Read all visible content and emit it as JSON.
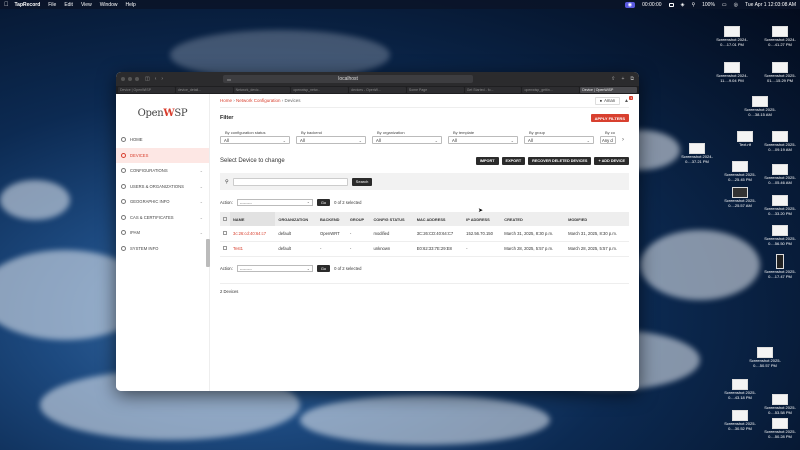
{
  "menubar": {
    "app": "TapRecord",
    "items": [
      "File",
      "Edit",
      "View",
      "Window",
      "Help"
    ],
    "recording_time": "00:00:00",
    "battery": "100%",
    "datetime": "Tue Apr 1 12:03:08 AM"
  },
  "desktop_icons": [
    {
      "label": "Screenshot 2024-0....41.27 PM"
    },
    {
      "label": "Screenshot 2024-0....17.01 PM"
    },
    {
      "label": "Screenshot 2025-01....15.29 PM"
    },
    {
      "label": "Screenshot 2024-11....9.04 PM"
    },
    {
      "label": "Screenshot 2025-0....38.15 AM"
    },
    {
      "label": "Text.rtf"
    },
    {
      "label": "Screenshot 2025-0....09.19 AM"
    },
    {
      "label": "Screenshot 2024-0....37.21 PM"
    },
    {
      "label": "Screenshot 2025-0....25.45 PM"
    },
    {
      "label": "Screenshot 2025-0....05.46 AM"
    },
    {
      "label": "Screenshot 2025-0....25.57 AM"
    },
    {
      "label": "Screenshot 2025-0....33.20 PM"
    },
    {
      "label": "Screenshot 2025-0....56.50 PM"
    },
    {
      "label": "Screenshot 2025-0....17.47 PM"
    },
    {
      "label": "Screenshot 2025-0....50.57 PM"
    },
    {
      "label": "Screenshot 2025-0....43.18 PM"
    },
    {
      "label": "Screenshot 2025-0....53.58 PM"
    },
    {
      "label": "Screenshot 2025-0....30.52 PM"
    },
    {
      "label": "Screenshot 2025-0....50.28 PM"
    }
  ],
  "browser": {
    "address": "localhost",
    "tabs": [
      "Device | OpenWISP",
      "device_detail...",
      "Network_devic...",
      "openwisp_netw...",
      "devices - OpenW...",
      "Some Page",
      "Get Started - fo...",
      "openwisp_gettin...",
      "Device | OpenWISP"
    ]
  },
  "sidebar": {
    "logo_left": "Open",
    "logo_mid": "W",
    "logo_right": "SP",
    "items": [
      {
        "label": "Home",
        "icon": "home-icon"
      },
      {
        "label": "Devices",
        "icon": "devices-icon"
      },
      {
        "label": "Configurations",
        "icon": "config-icon"
      },
      {
        "label": "Users & Organizations",
        "icon": "users-icon"
      },
      {
        "label": "Geographic Info",
        "icon": "map-icon"
      },
      {
        "label": "Cas & Certificates",
        "icon": "certificate-icon"
      },
      {
        "label": "IPAM",
        "icon": "ipam-icon"
      },
      {
        "label": "System Info",
        "icon": "info-icon"
      }
    ]
  },
  "topbar": {
    "breadcrumb_home": "Home",
    "breadcrumb_sep1": " › ",
    "breadcrumb_section": "Network Configuration",
    "breadcrumb_sep2": " › ",
    "breadcrumb_page": "Devices",
    "user": "Aman",
    "notif_count": "1"
  },
  "filter": {
    "title": "Filter",
    "apply_label": "APPLY FILTERS",
    "fields": [
      {
        "label": "By configuration status",
        "value": "All"
      },
      {
        "label": "By backend",
        "value": "All"
      },
      {
        "label": "By organization",
        "value": "All"
      },
      {
        "label": "By template",
        "value": "All"
      },
      {
        "label": "By group",
        "value": "All"
      },
      {
        "label": "By co",
        "value": "Any d"
      }
    ]
  },
  "page": {
    "title": "Select Device to change",
    "import_label": "IMPORT",
    "export_label": "EXPORT",
    "recover_label": "RECOVER DELETED DEVICES",
    "add_label": "+ ADD DEVICE",
    "search_label": "Search",
    "action_label": "Action:",
    "action_value": "---------",
    "go_label": "Go",
    "selected_text": "0 of 2 selected",
    "total": "2 Devices"
  },
  "table": {
    "columns": [
      "Name",
      "Organization",
      "Backend",
      "Group",
      "Config Status",
      "MAC Address",
      "IP Address",
      "Created",
      "Modified"
    ],
    "rows": [
      [
        "3c:26:cd:40:64:c7",
        "default",
        "OpenWRT",
        "-",
        "modified",
        "3C:26:CD:40:64:C7",
        "152.56.70.150",
        "March 31, 2025, 8:30 p.m.",
        "March 31, 2025, 8:30 p.m."
      ],
      [
        "Test1",
        "default",
        "-",
        "-",
        "unknown",
        "E0:62:33:7E:29:E8",
        "-",
        "March 28, 2025, 5:57 p.m.",
        "March 28, 2025, 5:57 p.m."
      ]
    ]
  },
  "colors": {
    "accent": "#d8402f",
    "dark_button": "#2b2b2b"
  }
}
